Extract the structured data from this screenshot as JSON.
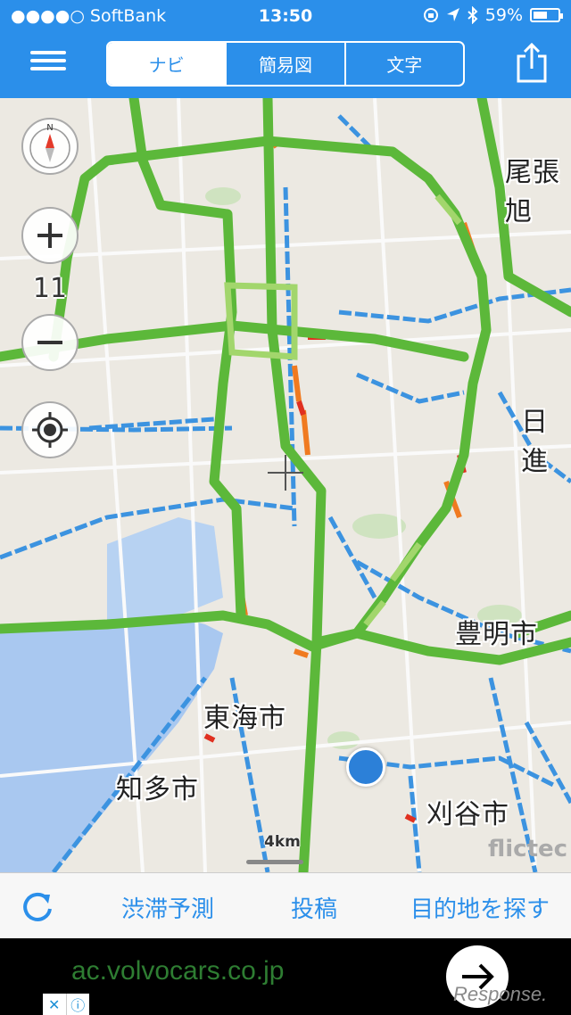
{
  "status_bar": {
    "carrier": "●●●●○ SoftBank",
    "time": "13:50",
    "battery": "59%",
    "battery_level": 0.59
  },
  "header": {
    "tabs": [
      {
        "label": "ナビ",
        "selected": true
      },
      {
        "label": "簡易図",
        "selected": false
      },
      {
        "label": "文字",
        "selected": false
      }
    ],
    "icons": [
      "menu-icon",
      "share-icon"
    ]
  },
  "map": {
    "zoom_level": "11",
    "scale": "4km",
    "brand": "flictec",
    "place_labels": [
      "尾張旭",
      "日進",
      "豊明市",
      "東海市",
      "知多市",
      "刈谷市"
    ],
    "colors": {
      "land": "#ece9e2",
      "water": "#a9c8f0",
      "highway": "#5cb83a",
      "highway_light": "#a2d66c",
      "road": "#3c93e0",
      "congestion": "#f07a20",
      "heavy_congestion": "#e03020",
      "location": "#2c80d8"
    }
  },
  "toolbar": {
    "items": [
      "渋滞予測",
      "投稿",
      "目的地を探す"
    ]
  },
  "ad": {
    "url": "ac.volvocars.co.jp",
    "watermark": "Response."
  }
}
